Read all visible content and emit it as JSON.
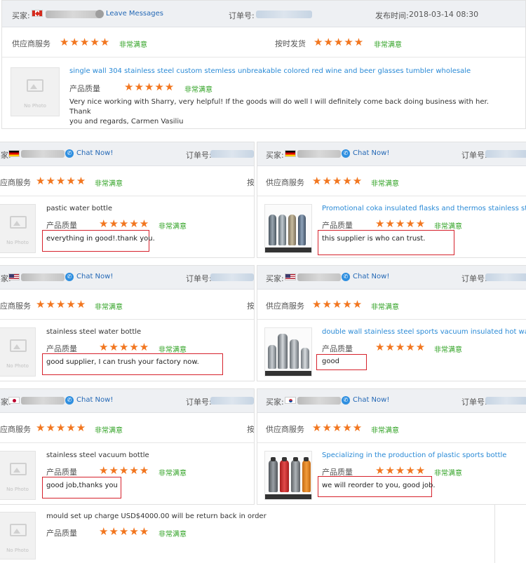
{
  "labels": {
    "buyer": "买家:",
    "order_no": "订单号:",
    "publish_time": "发布时间:",
    "supplier_service": "供应商服务",
    "supplier_service_cut": "应商服务",
    "on_time_delivery": "按时发货",
    "on_time_delivery_cut": "按",
    "product_quality": "产品质量",
    "very_satisfied": "非常满意",
    "leave_messages": "Leave Messages",
    "chat_now": "Chat Now!",
    "no_photo": "No Photo",
    "stars": "★★★★★"
  },
  "colors": {
    "star": "#f2761f",
    "satisfied": "#2ea121",
    "link": "#2a8ad6",
    "highlight_box": "#d6222c",
    "header_bg": "#eef0f3"
  },
  "review_main": {
    "country": "Canada",
    "date": "2018-03-14 08:30",
    "product": "single wall 304 stainless steel custom stemless unbreakable colored red wine and beer glasses tumbler wholesale",
    "comment_line1": "Very nice working with Sharry, very helpful! If the goods will do well I will definitely come back doing business with her. Thank",
    "comment_line2": "you and regards, Carmen Vasiliu"
  },
  "reviews_left": [
    {
      "country": "Germany",
      "product": "pastic water bottle",
      "comment": "everything in good!.thank you."
    },
    {
      "country": "United States",
      "product": "stainless steel water bottle",
      "comment": "good supplier, I can trush your factory now."
    },
    {
      "country": "Japan",
      "product": "stainless steel vacuum bottle",
      "comment": "good job,thanks you"
    }
  ],
  "reviews_right": [
    {
      "country": "Germany",
      "product": "Promotional coka insulated flasks and thermos stainless steel water bottle",
      "comment": "this supplier is who can trust."
    },
    {
      "country": "United States",
      "product": "double wall stainless steel sports vacuum insulated hot water flask",
      "comment": "good"
    },
    {
      "country": "South Korea",
      "product": "Specializing in the production of plastic sports bottle",
      "comment": "we will reorder to you, good job."
    }
  ],
  "review_last": {
    "product": "mould set up charge USD$4000.00 will be return back in order"
  }
}
